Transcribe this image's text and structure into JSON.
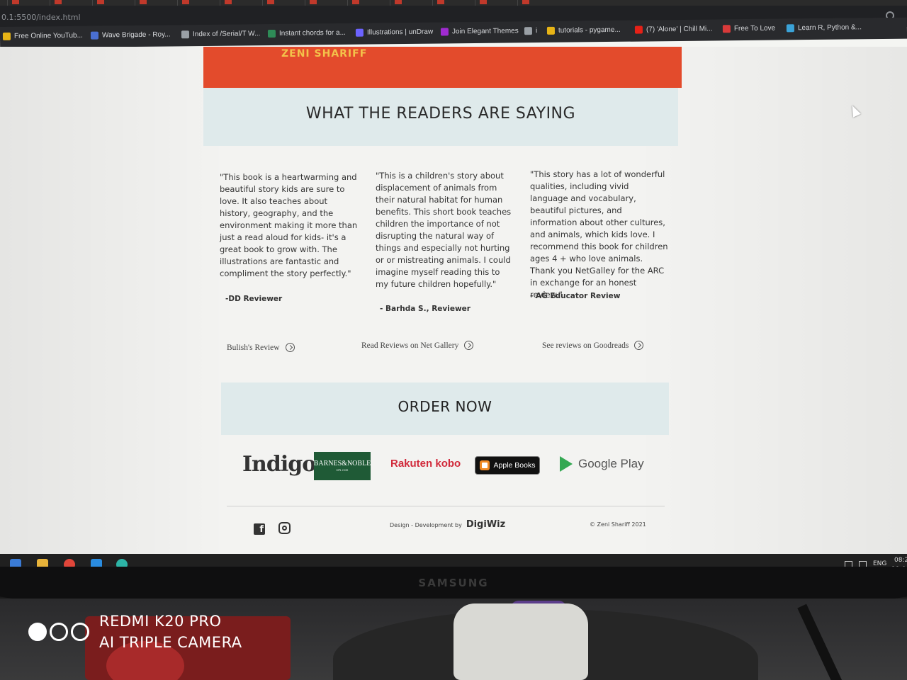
{
  "browser": {
    "url": "0.1:5500/index.html",
    "bookmarks": [
      {
        "label": "Free Online YouTub...",
        "color": "#e7b416"
      },
      {
        "label": "Wave Brigade - Roy...",
        "color": "#4a6fd1"
      },
      {
        "label": "Index of /Serial/T W...",
        "color": "#9aa0a6"
      },
      {
        "label": "Instant chords for a...",
        "color": "#2e8b57"
      },
      {
        "label": "Illustrations | unDraw",
        "color": "#6c63ff"
      },
      {
        "label": "Join Elegant Themes",
        "color": "#a02bd0"
      },
      {
        "label": "i",
        "color": "#9aa0a6"
      },
      {
        "label": "tutorials - pygame...",
        "color": "#e7b416"
      },
      {
        "label": "(7) 'Alone' | Chill Mi...",
        "color": "#e62117"
      },
      {
        "label": "Free To Love",
        "color": "#d93a3a"
      },
      {
        "label": "Learn R, Python &...",
        "color": "#3ba3d8"
      }
    ]
  },
  "page": {
    "cover_text": "ZENI SHARIFF",
    "readers_title": "WHAT THE READERS ARE SAYING",
    "reviews": [
      {
        "quote": "\"This book is a heartwarming and beautiful story kids are sure to love. It also teaches about history, geography, and the environment making it more than just a read aloud for kids- it's a great book to grow with. The illustrations are fantastic and compliment the story perfectly.\"",
        "author": "-DD Reviewer"
      },
      {
        "quote": "\"This is a children's story about displacement of animals from their natural habitat for human benefits. This short book teaches children the importance of not disrupting the natural way of things and especially not hurting or or mistreating animals. I could imagine myself reading this to my future children hopefully.\"",
        "author": "- Barhda S., Reviewer"
      },
      {
        "quote": "\"This story has a lot of wonderful qualities, including vivid language and vocabulary, beautiful pictures, and information about other cultures, and animals, which kids love. I recommend this book for children ages 4 + who love animals. Thank you NetGalley for the ARC in exchange for an honest review.\"",
        "author": "- AG Educator Review"
      }
    ],
    "review_links": [
      "Bulish's Review",
      "Read Reviews on Net Gallery",
      "See reviews on Goodreads"
    ],
    "order_now": "ORDER NOW",
    "stores": {
      "indigo": "Indigo",
      "bn": "BARNES&NOBLE",
      "bn_sub": "BN.com",
      "kobo": "Rakuten kobo",
      "apple": "Apple Books",
      "google": "Google Play"
    },
    "footer": {
      "credit_label": "Design - Development by",
      "credit_brand": "DigiWiz",
      "copyright": "© Zeni Shariff 2021"
    }
  },
  "taskbar": {
    "lang": "ENG",
    "time": "08:2",
    "date": "19-0"
  },
  "monitor_brand": "SAMSUNG",
  "watermark": {
    "line1": "REDMI K20 PRO",
    "line2": "AI TRIPLE CAMERA"
  },
  "colors": {
    "accent_box": "#dfeaeb",
    "cover": "#e34b2c",
    "barnes_green": "#1f5a36",
    "kobo_red": "#d12a3b"
  }
}
